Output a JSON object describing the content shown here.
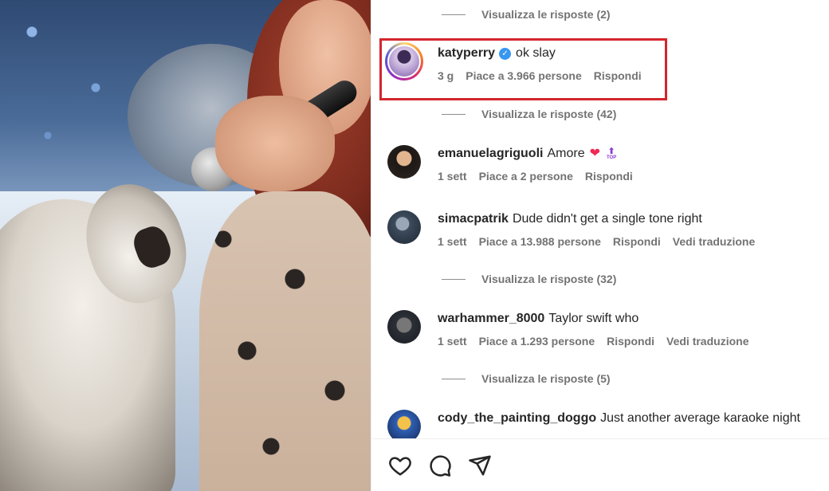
{
  "replies": [
    "Visualizza le risposte (2)",
    "Visualizza le risposte (42)",
    "Visualizza le risposte (32)",
    "Visualizza le risposte (5)"
  ],
  "comments": [
    {
      "username": "katyperry",
      "text": "ok slay",
      "time": "3 g",
      "likes": "Piace a 3.966 persone",
      "reply": "Rispondi",
      "verified": true,
      "highlighted": true
    },
    {
      "username": "emanuelagriguoli",
      "text": "Amore",
      "time": "1 sett",
      "likes": "Piace a 2 persone",
      "reply": "Rispondi"
    },
    {
      "username": "simacpatrik",
      "text": "Dude didn't get a single tone right",
      "time": "1 sett",
      "likes": "Piace a 13.988 persone",
      "reply": "Rispondi",
      "translate": "Vedi traduzione"
    },
    {
      "username": "warhammer_8000",
      "text": "Taylor swift who",
      "time": "1 sett",
      "likes": "Piace a 1.293 persone",
      "reply": "Rispondi",
      "translate": "Vedi traduzione"
    },
    {
      "username": "cody_the_painting_doggo",
      "text": "Just another average karaoke night"
    }
  ],
  "emoji": {
    "heart": "❤",
    "top_badge": "TOP"
  },
  "colors": {
    "highlight": "#d3262d",
    "verified": "#3897f0",
    "muted": "#737373",
    "text": "#262626"
  },
  "actions": {
    "like": "heart-icon",
    "comment": "comment-icon",
    "share": "send-icon"
  }
}
